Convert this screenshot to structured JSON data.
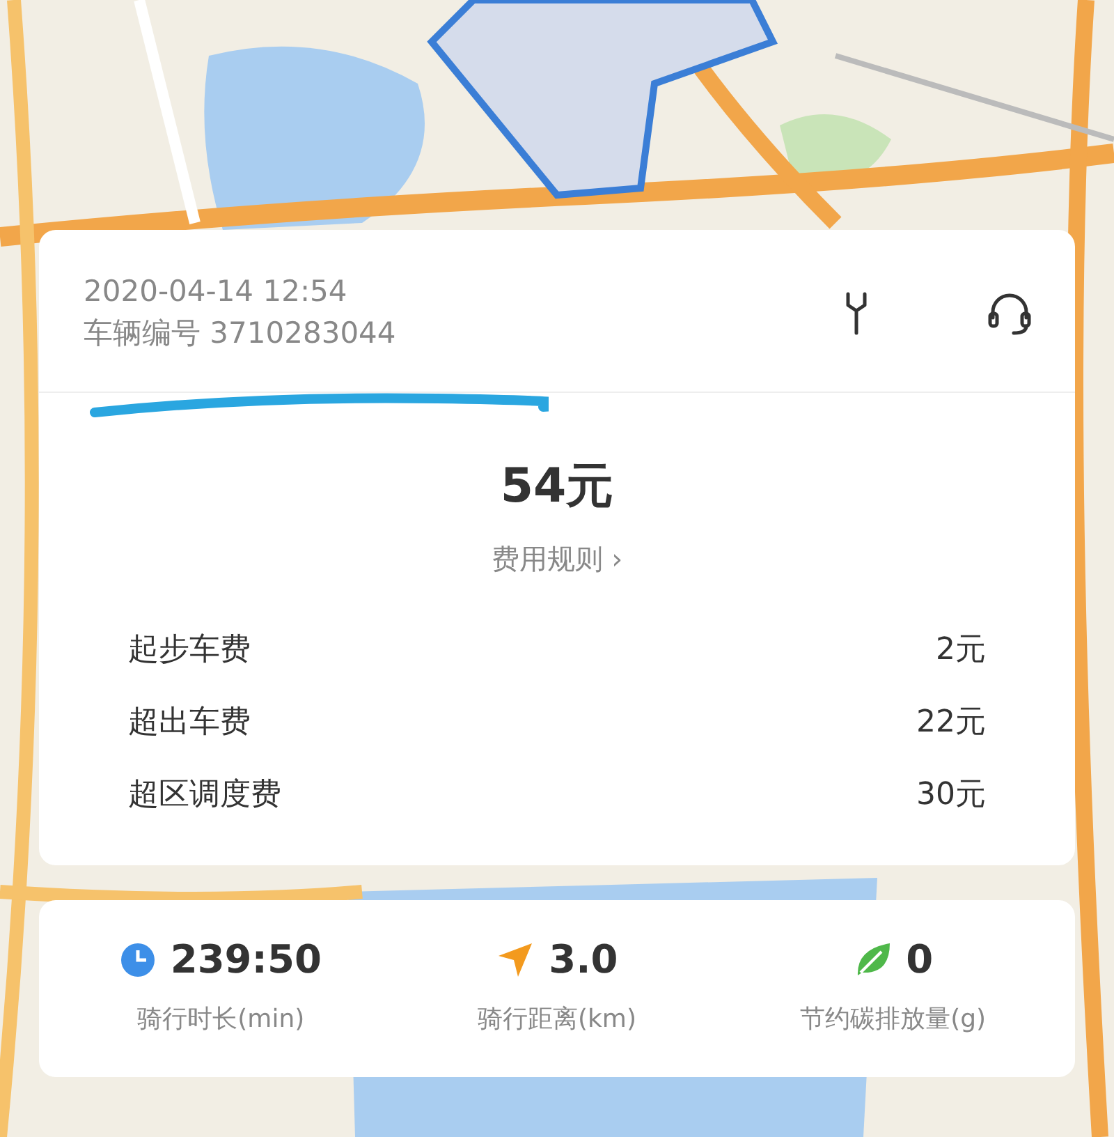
{
  "trip": {
    "datetime": "2020-04-14 12:54",
    "vehicle_number": "车辆编号 3710283044",
    "total": "54元",
    "rules_link": "费用规则 ›",
    "fees": [
      {
        "label": "起步车费",
        "amount": "2元"
      },
      {
        "label": "超出车费",
        "amount": "22元"
      },
      {
        "label": "超区调度费",
        "amount": "30元"
      }
    ]
  },
  "stats": [
    {
      "kind": "time",
      "value": "239:50",
      "label": "骑行时长(min)"
    },
    {
      "kind": "distance",
      "value": "3.0",
      "label": "骑行距离(km)"
    },
    {
      "kind": "carbon",
      "value": "0",
      "label": "节约碳排放量(g)"
    }
  ]
}
